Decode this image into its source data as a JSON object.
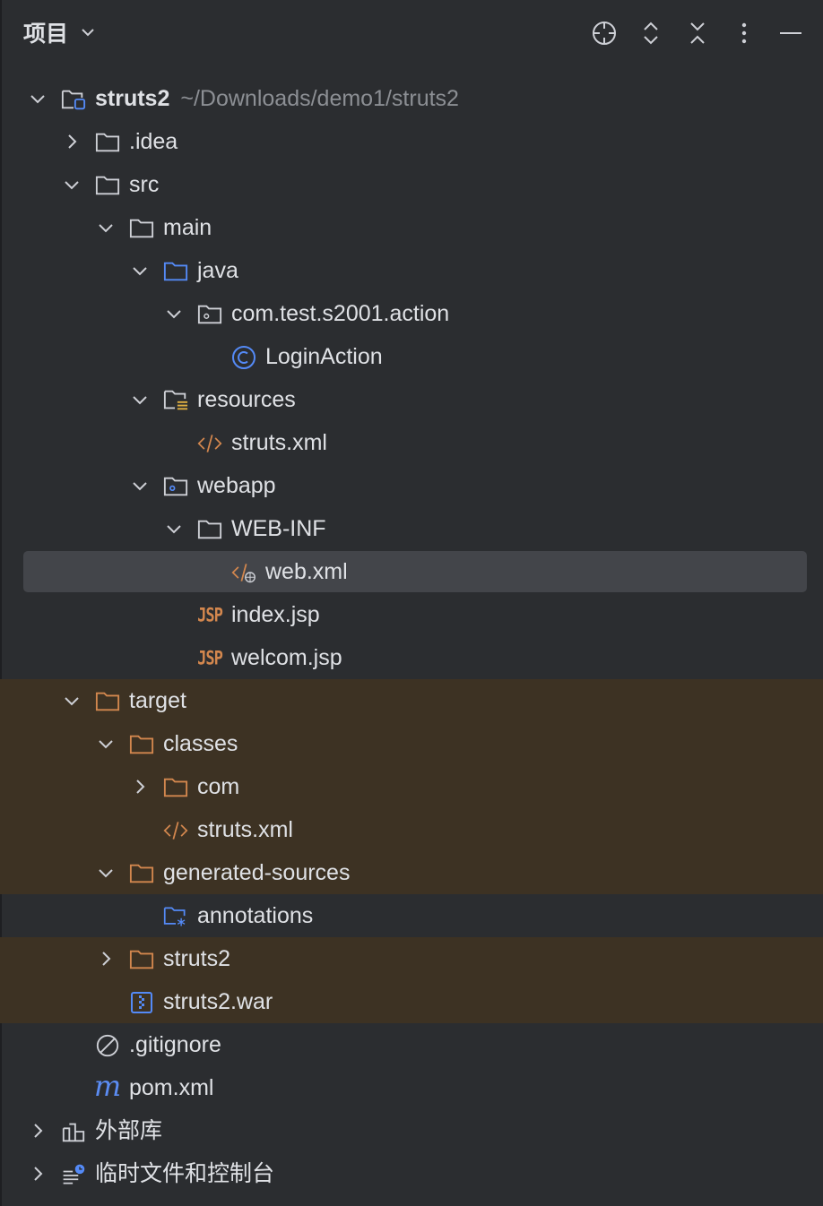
{
  "header": {
    "title": "项目",
    "icons": [
      "title-dropdown-chevron-icon",
      "locate-icon",
      "expand-all-icon",
      "collapse-all-icon",
      "more-options-icon",
      "minimize-icon"
    ]
  },
  "tree": {
    "root": {
      "name": "struts2",
      "path": "~/Downloads/demo1/struts2"
    },
    "idea": ".idea",
    "src": "src",
    "main": "main",
    "java": "java",
    "package": "com.test.s2001.action",
    "login_action": "LoginAction",
    "resources": "resources",
    "struts_xml_src": "struts.xml",
    "webapp": "webapp",
    "web_inf": "WEB-INF",
    "web_xml": "web.xml",
    "index_jsp": "index.jsp",
    "welcom_jsp": "welcom.jsp",
    "target": "target",
    "classes": "classes",
    "com": "com",
    "struts_xml_classes": "struts.xml",
    "generated_sources": "generated-sources",
    "annotations": "annotations",
    "struts2_dir": "struts2",
    "struts2_war": "struts2.war",
    "gitignore": ".gitignore",
    "pom_xml": "pom.xml",
    "external_libs": "外部库",
    "scratches": "临时文件和控制台"
  },
  "badges": {
    "jsp": "JSP",
    "maven": "m"
  },
  "colors": {
    "background": "#2b2d30",
    "selected_row": "#43454a",
    "excluded_row": "#3d3223",
    "folder_gray": "#ced0d6",
    "folder_blue": "#548af7",
    "folder_orange": "#d3874e",
    "xml_orange": "#d3874e",
    "class_blue": "#548af7",
    "path_gray": "#8c8f94",
    "text": "#dfe1e5"
  },
  "selected_item": "web.xml"
}
